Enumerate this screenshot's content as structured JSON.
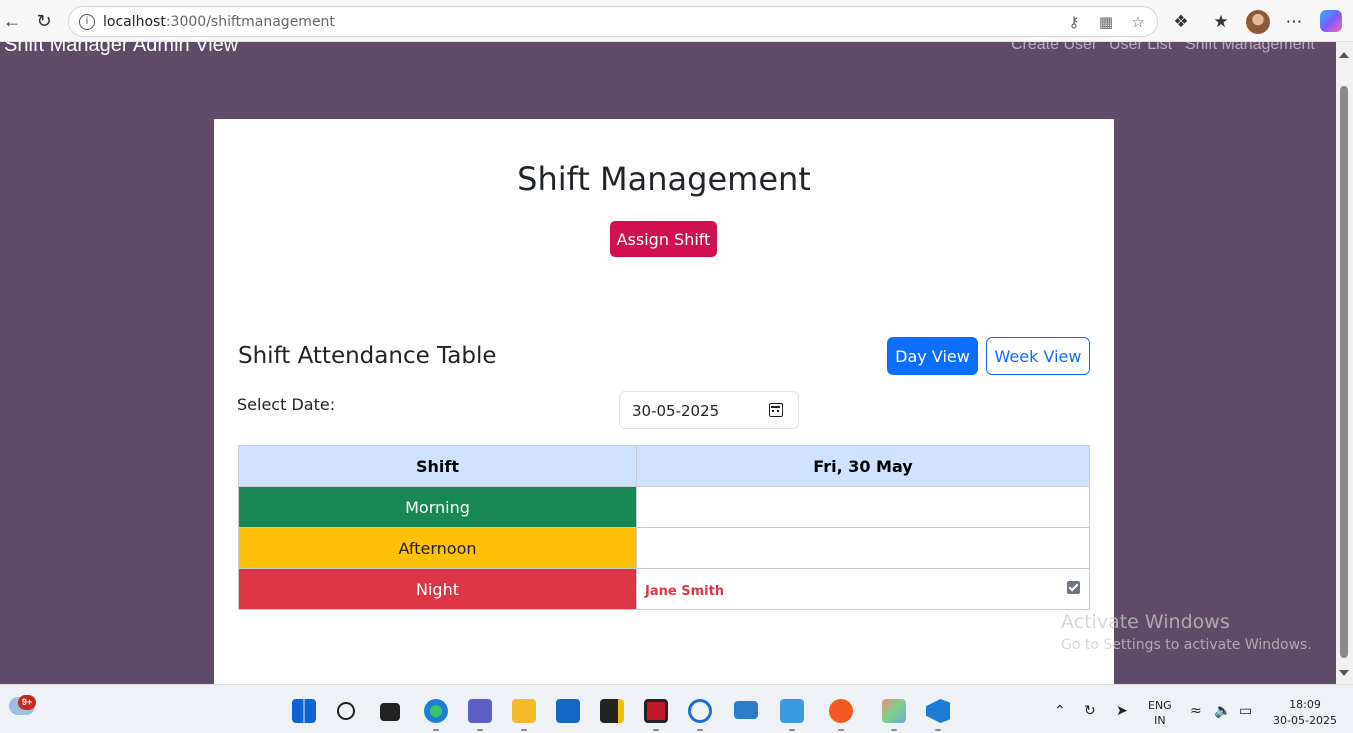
{
  "browser": {
    "url": "localhost:3000/shiftmanagement",
    "url_host": "localhost",
    "url_rest": ":3000/shiftmanagement"
  },
  "navbar": {
    "brand": "Shift Manager Admin View",
    "links": [
      "Create User",
      "User List",
      "Shift Management"
    ]
  },
  "page": {
    "title": "Shift Management",
    "assign_button": "Assign Shift"
  },
  "attendance": {
    "title": "Shift Attendance Table",
    "day_view_label": "Day View",
    "week_view_label": "Week View",
    "select_date_label": "Select Date:",
    "date_value": "30-05-2025",
    "headers": [
      "Shift",
      "Fri, 30 May"
    ],
    "rows": [
      {
        "shift": "Morning",
        "color": "#198754",
        "employee": ""
      },
      {
        "shift": "Afternoon",
        "color": "#ffc107",
        "employee": ""
      },
      {
        "shift": "Night",
        "color": "#dc3545",
        "employee": "Jane Smith"
      }
    ]
  },
  "watermark": {
    "title": "Activate Windows",
    "subtitle": "Go to Settings to activate Windows."
  },
  "taskbar": {
    "notification_count": "9+",
    "lang_top": "ENG",
    "lang_bottom": "IN",
    "time": "18:09",
    "date": "30-05-2025"
  },
  "colors": {
    "background": "#5f4a67",
    "primary": "#0d6efd",
    "assign": "#d0104f",
    "table_header": "#cfe2ff"
  }
}
